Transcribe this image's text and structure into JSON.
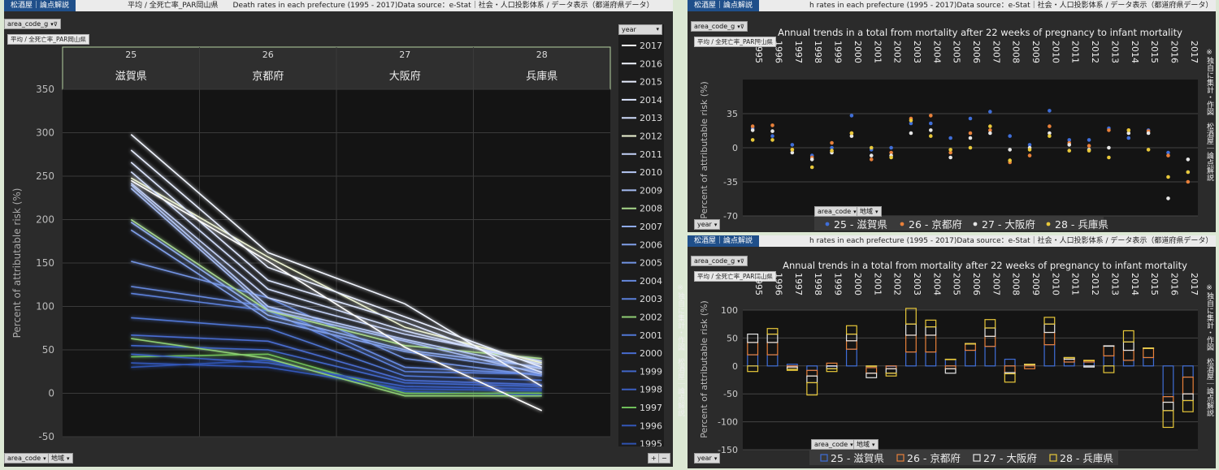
{
  "colors": {
    "lines": {
      "2017": "#ffffff",
      "2016": "#f2f6ff",
      "2015": "#e8eeff",
      "2014": "#dde6ff",
      "2013": "#d0dcfb",
      "2012": "#eef4d4",
      "2011": "#c3d1f7",
      "2010": "#b6c8f5",
      "2009": "#a5bbf2",
      "2008": "#a9d98b",
      "2007": "#8fabec",
      "2006": "#809fe8",
      "2005": "#7394e4",
      "2004": "#6689df",
      "2003": "#5b80da",
      "2002": "#8fce74",
      "2001": "#5076d4",
      "2000": "#486ccf",
      "1999": "#4166c8",
      "1998": "#3b5fc2",
      "1997": "#6fbf5a",
      "1996": "#3357b8",
      "1995": "#2f52b0"
    },
    "pref": {
      "25": "#3f6ed8",
      "26": "#e8803a",
      "27": "#e6e6e6",
      "28": "#e8c83a"
    }
  },
  "left_panel": {
    "brand": "松酒屋｜論点解説",
    "title": "平均 / 全死亡率_PAR岡山県　　Death rates in each prefecture (1995 - 2017)Data source：e-Stat｜社会・人口投影体系 / データ表示（都道府県データ）",
    "filter_area_code": "area_code_g",
    "measure_pill": "平均 / 全死亡率_PAR岡山県",
    "bottom_area_code": "area_code",
    "bottom_region": "地域",
    "year_filter": "year",
    "zoom_plus": "+",
    "zoom_minus": "−"
  },
  "right_top": {
    "brand": "松酒屋｜論点解説",
    "title": "h rates in each prefecture (1995 - 2017)Data source：e-Stat｜社会・人口投影体系 / データ表示（都道府県データ）",
    "filter_area_code": "area_code_g",
    "measure_pill": "平均 / 全死亡率_PAR岡山県",
    "bottom_area_code": "area_code",
    "bottom_region": "地域",
    "year_filter": "year",
    "side_text": "※独自に集計・作図　松酒屋｜論点解説"
  },
  "right_bottom": {
    "brand": "松酒屋｜論点解説",
    "title": "h rates in each prefecture (1995 - 2017)Data source：e-Stat｜社会・人口投影体系 / データ表示（都道府県データ）",
    "filter_area_code": "area_code_g",
    "measure_pill": "平均 / 全死亡率_PAR岡山県",
    "bottom_area_code": "area_code",
    "bottom_region": "地域",
    "year_filter": "year",
    "side_text_left": "※独自に集計・作図　松酒屋｜論点解説",
    "side_text_right": "※独自に集計・作図　松酒屋｜論点解説"
  },
  "chart_data": [
    {
      "type": "line",
      "title": "",
      "ylabel": "Percent of attributable risk (%)",
      "ylim": [
        -50,
        350
      ],
      "yticks": [
        -50,
        0,
        50,
        100,
        150,
        200,
        250,
        300,
        350
      ],
      "categories": [
        {
          "code": "25",
          "name": "滋賀県"
        },
        {
          "code": "26",
          "name": "京都府"
        },
        {
          "code": "27",
          "name": "大阪府"
        },
        {
          "code": "28",
          "name": "兵庫県"
        }
      ],
      "series": [
        {
          "name": "2017",
          "values": [
            245,
            152,
            53,
            -20
          ]
        },
        {
          "name": "2016",
          "values": [
            298,
            162,
            103,
            8
          ]
        },
        {
          "name": "2015",
          "values": [
            280,
            145,
            88,
            30
          ]
        },
        {
          "name": "2014",
          "values": [
            266,
            130,
            82,
            24
          ]
        },
        {
          "name": "2013",
          "values": [
            255,
            120,
            72,
            33
          ]
        },
        {
          "name": "2012",
          "values": [
            248,
            157,
            76,
            35
          ]
        },
        {
          "name": "2011",
          "values": [
            242,
            110,
            68,
            37
          ]
        },
        {
          "name": "2010",
          "values": [
            240,
            100,
            62,
            28
          ]
        },
        {
          "name": "2009",
          "values": [
            236,
            96,
            60,
            22
          ]
        },
        {
          "name": "2008",
          "values": [
            200,
            95,
            55,
            40
          ]
        },
        {
          "name": "2007",
          "values": [
            197,
            90,
            50,
            30
          ]
        },
        {
          "name": "2006",
          "values": [
            188,
            85,
            48,
            25
          ]
        },
        {
          "name": "2005",
          "values": [
            152,
            110,
            40,
            20
          ]
        },
        {
          "name": "2004",
          "values": [
            123,
            100,
            30,
            22
          ]
        },
        {
          "name": "2003",
          "values": [
            115,
            95,
            25,
            22
          ]
        },
        {
          "name": "2002",
          "values": [
            63,
            40,
            -3,
            -3
          ]
        },
        {
          "name": "2001",
          "values": [
            87,
            75,
            20,
            15
          ]
        },
        {
          "name": "2000",
          "values": [
            67,
            60,
            15,
            10
          ]
        },
        {
          "name": "1999",
          "values": [
            55,
            50,
            12,
            8
          ]
        },
        {
          "name": "1998",
          "values": [
            45,
            35,
            8,
            5
          ]
        },
        {
          "name": "1997",
          "values": [
            42,
            45,
            0,
            0
          ]
        },
        {
          "name": "1996",
          "values": [
            35,
            30,
            5,
            3
          ]
        },
        {
          "name": "1995",
          "values": [
            30,
            38,
            2,
            -2
          ]
        }
      ],
      "legend_title": "year",
      "legend_placement": "right"
    },
    {
      "type": "scatter",
      "title": "Annual trends in a total from mortality after 22 weeks of pregnancy to infant mortality",
      "ylabel": "Percent of attributable risk (%)",
      "ylim": [
        -70,
        70
      ],
      "yticks": [
        -70,
        -35,
        0,
        35
      ],
      "x": [
        1995,
        1996,
        1997,
        1998,
        1999,
        2000,
        2001,
        2002,
        2003,
        2004,
        2005,
        2006,
        2007,
        2008,
        2009,
        2010,
        2011,
        2012,
        2013,
        2014,
        2015,
        2016,
        2017
      ],
      "series": [
        {
          "name": "25 - 滋賀県",
          "values": [
            20,
            12,
            3,
            -8,
            0,
            33,
            -2,
            0,
            25,
            25,
            10,
            30,
            37,
            12,
            3,
            38,
            8,
            8,
            20,
            10,
            18,
            -5,
            -25
          ]
        },
        {
          "name": "26 - 京都府",
          "values": [
            22,
            23,
            -2,
            -10,
            5,
            15,
            -12,
            -5,
            30,
            33,
            -5,
            15,
            18,
            -15,
            -8,
            22,
            5,
            2,
            18,
            18,
            17,
            -8,
            -35
          ]
        },
        {
          "name": "27 - 大阪府",
          "values": [
            18,
            17,
            -5,
            -12,
            -5,
            12,
            -8,
            -8,
            15,
            18,
            -10,
            10,
            15,
            -2,
            0,
            15,
            3,
            -2,
            0,
            15,
            15,
            -52,
            -12
          ]
        },
        {
          "name": "28 - 兵庫県",
          "values": [
            8,
            8,
            -2,
            -20,
            -3,
            15,
            0,
            -10,
            28,
            12,
            -2,
            0,
            22,
            -13,
            -2,
            12,
            -3,
            -3,
            -10,
            18,
            -2,
            -30,
            -25
          ]
        }
      ],
      "legend_placement": "bottom"
    },
    {
      "type": "bar",
      "title": "Annual trends in a total from mortality after 22 weeks of pregnancy to infant mortality",
      "ylabel": "Percent of attributable risk (%)",
      "ylim": [
        -150,
        100
      ],
      "yticks": [
        -150,
        -100,
        -50,
        0,
        50,
        100
      ],
      "x": [
        1995,
        1996,
        1997,
        1998,
        1999,
        2000,
        2001,
        2002,
        2003,
        2004,
        2005,
        2006,
        2007,
        2008,
        2009,
        2010,
        2011,
        2012,
        2013,
        2014,
        2015,
        2016,
        2017
      ],
      "stacked": true,
      "series": [
        {
          "name": "25 - 滋賀県",
          "values": [
            20,
            20,
            3,
            -8,
            0,
            30,
            -3,
            0,
            25,
            25,
            12,
            28,
            35,
            12,
            3,
            38,
            7,
            7,
            18,
            10,
            15,
            -55,
            -20
          ]
        },
        {
          "name": "26 - 京都府",
          "values": [
            22,
            22,
            -2,
            -10,
            5,
            15,
            -10,
            -5,
            30,
            30,
            -5,
            12,
            18,
            -12,
            -5,
            22,
            5,
            3,
            18,
            18,
            17,
            -10,
            -30
          ]
        },
        {
          "name": "27 - 大阪府",
          "values": [
            15,
            15,
            -4,
            -12,
            -5,
            12,
            -8,
            -8,
            20,
            15,
            -8,
            0,
            15,
            -2,
            0,
            15,
            3,
            -2,
            0,
            15,
            0,
            -15,
            -12
          ]
        },
        {
          "name": "28 - 兵庫県",
          "values": [
            -10,
            10,
            -2,
            -22,
            -5,
            15,
            0,
            -5,
            28,
            12,
            0,
            0,
            15,
            -15,
            0,
            12,
            0,
            0,
            -12,
            20,
            0,
            -30,
            -20
          ]
        }
      ],
      "legend_placement": "bottom"
    }
  ]
}
